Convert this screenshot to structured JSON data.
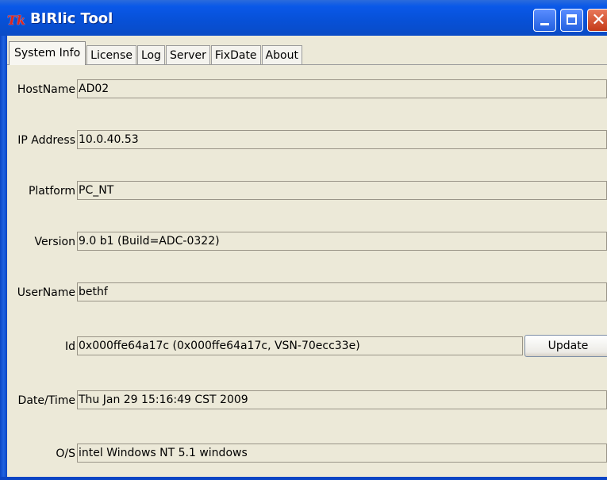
{
  "window": {
    "title": "BIRlic Tool",
    "icon": "Tk"
  },
  "tabs": [
    {
      "label": "System Info",
      "active": true
    },
    {
      "label": "License",
      "active": false
    },
    {
      "label": "Log",
      "active": false
    },
    {
      "label": "Server",
      "active": false
    },
    {
      "label": "FixDate",
      "active": false
    },
    {
      "label": "About",
      "active": false
    }
  ],
  "fields": {
    "hostname": {
      "label": "HostName",
      "value": "AD02"
    },
    "ip": {
      "label": "IP Address",
      "value": "10.0.40.53"
    },
    "platform": {
      "label": "Platform",
      "value": "PC_NT"
    },
    "version": {
      "label": "Version",
      "value": "9.0 b1  (Build=ADC-0322)"
    },
    "username": {
      "label": "UserName",
      "value": "bethf"
    },
    "id": {
      "label": "Id",
      "value": "0x000ffe64a17c  (0x000ffe64a17c, VSN-70ecc33e)"
    },
    "datetime": {
      "label": "Date/Time",
      "value": "Thu Jan 29 15:16:49 CST 2009"
    },
    "os": {
      "label": "O/S",
      "value": "intel Windows NT 5.1 windows"
    }
  },
  "buttons": {
    "update": "Update"
  },
  "colors": {
    "titlebar": "#0750d6",
    "client_bg": "#ece9d8",
    "close_button": "#c43a18"
  }
}
